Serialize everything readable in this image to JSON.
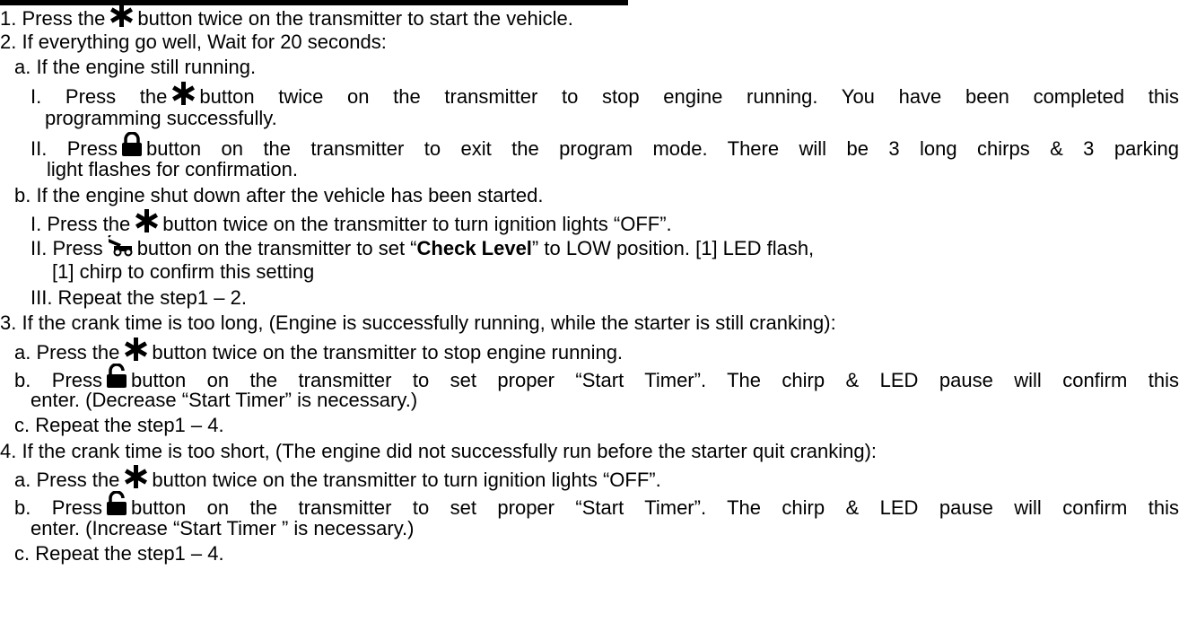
{
  "steps": {
    "s1": {
      "pre": "1. Press the",
      "post": "button twice on the transmitter to start the vehicle."
    },
    "s2": "2. If everything go well, Wait for 20 seconds:",
    "s2a": "a. If the engine still running.",
    "s2a1": {
      "pre": "I. Press the",
      "post": "button twice on the transmitter to stop engine running. You have been completed this"
    },
    "s2a1_cont": "programming successfully.",
    "s2a2": {
      "pre": "II. Press",
      "post": "button on the transmitter to exit the program mode. There will be 3 long chirps & 3 parking"
    },
    "s2a2_cont": "light flashes for confirmation.",
    "s2b": "b. If the engine shut down after the vehicle has been started.",
    "s2b1": {
      "pre": "I. Press the",
      "post": "button twice on the transmitter to turn ignition lights “OFF”."
    },
    "s2b2": {
      "pre": "II. Press",
      "mid": "button on the transmitter to set “",
      "bold": "Check Level",
      "post": "” to LOW position. [1] LED flash,"
    },
    "s2b2_cont": "[1] chirp to confirm this setting",
    "s2b3": "III. Repeat the step1 – 2.",
    "s3": "3. If the crank time is too long, (Engine is successfully running, while the starter is still cranking):",
    "s3a": {
      "pre": "a. Press the",
      "post": "button twice on the transmitter to stop engine running."
    },
    "s3b": {
      "pre": "b. Press",
      "post": "button on the transmitter to set proper “Start Timer”. The chirp & LED pause will confirm this"
    },
    "s3b_cont": "enter. (Decrease “Start Timer” is necessary.)",
    "s3c": "c. Repeat the step1 – 4.",
    "s4": "4. If the crank time is too short, (The engine did not successfully run before the starter quit cranking):",
    "s4a": {
      "pre": "a. Press the",
      "post": "button twice on the transmitter to turn ignition lights “OFF”."
    },
    "s4b": {
      "pre": "b. Press",
      "post": "button on the transmitter to set proper “Start Timer”. The chirp & LED pause will confirm this"
    },
    "s4b_cont": "enter. (Increase “Start Timer ” is necessary.)",
    "s4c": "c. Repeat the step1 – 4."
  },
  "icons": {
    "star": "asterisk-icon",
    "lock": "lock-icon",
    "unlock": "unlock-icon",
    "trunk": "car-trunk-icon"
  }
}
